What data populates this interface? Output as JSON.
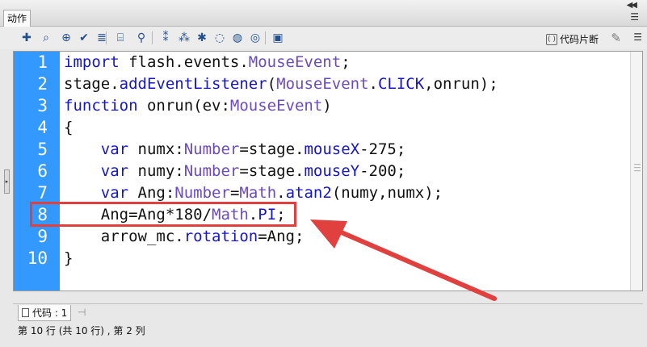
{
  "panel": {
    "tab_label": "动作",
    "collapse_glyph": "◀◀",
    "menu_glyph": "☰"
  },
  "toolbar": {
    "icons": [
      {
        "name": "add-statement-icon",
        "glyph": "✚"
      },
      {
        "name": "find-icon",
        "glyph": "⌕"
      },
      {
        "name": "target-path-icon",
        "glyph": "⊕"
      },
      {
        "name": "check-syntax-icon",
        "glyph": "✔"
      },
      {
        "name": "auto-format-icon",
        "glyph": "≣"
      },
      {
        "name": "show-code-hint-icon",
        "glyph": "⌸"
      },
      {
        "name": "debug-options-icon",
        "glyph": "⚲"
      },
      {
        "name": "collapse-braces-icon",
        "glyph": "⁑"
      },
      {
        "name": "collapse-selection-icon",
        "glyph": "⁂"
      },
      {
        "name": "expand-all-icon",
        "glyph": "✱"
      },
      {
        "name": "apply-block-comment-icon",
        "glyph": "◌"
      },
      {
        "name": "apply-line-comment-icon",
        "glyph": "◍"
      },
      {
        "name": "remove-comment-icon",
        "glyph": "◎"
      },
      {
        "name": "show-hide-toolbox-icon",
        "glyph": "▣"
      }
    ],
    "snippets_label": "代码片断",
    "snippets_icon": "( )",
    "wizard_glyph": "✎",
    "menu_glyph": "☰"
  },
  "editor": {
    "line_numbers": [
      "1",
      "2",
      "3",
      "4",
      "5",
      "6",
      "7",
      "8",
      "9",
      "10"
    ],
    "lines": [
      [
        {
          "t": "import",
          "c": "kw"
        },
        {
          "t": " flash.events.",
          "c": ""
        },
        {
          "t": "MouseEvent",
          "c": "tp"
        },
        {
          "t": ";",
          "c": ""
        }
      ],
      [
        {
          "t": "stage.",
          "c": ""
        },
        {
          "t": "addEventListener",
          "c": "kw"
        },
        {
          "t": "(",
          "c": ""
        },
        {
          "t": "MouseEvent",
          "c": "tp"
        },
        {
          "t": ".",
          "c": ""
        },
        {
          "t": "CLICK",
          "c": "kw"
        },
        {
          "t": ",onrun);",
          "c": ""
        }
      ],
      [
        {
          "t": "function",
          "c": "kw"
        },
        {
          "t": " onrun(ev:",
          "c": ""
        },
        {
          "t": "MouseEvent",
          "c": "tp"
        },
        {
          "t": ")",
          "c": ""
        }
      ],
      [
        {
          "t": "{",
          "c": ""
        }
      ],
      [
        {
          "t": "    ",
          "c": ""
        },
        {
          "t": "var",
          "c": "kw"
        },
        {
          "t": " numx:",
          "c": ""
        },
        {
          "t": "Number",
          "c": "tp"
        },
        {
          "t": "=stage.",
          "c": ""
        },
        {
          "t": "mouseX",
          "c": "kw"
        },
        {
          "t": "-275;",
          "c": ""
        }
      ],
      [
        {
          "t": "    ",
          "c": ""
        },
        {
          "t": "var",
          "c": "kw"
        },
        {
          "t": " numy:",
          "c": ""
        },
        {
          "t": "Number",
          "c": "tp"
        },
        {
          "t": "=stage.",
          "c": ""
        },
        {
          "t": "mouseY",
          "c": "kw"
        },
        {
          "t": "-200;",
          "c": ""
        }
      ],
      [
        {
          "t": "    ",
          "c": ""
        },
        {
          "t": "var",
          "c": "kw"
        },
        {
          "t": " Ang:",
          "c": ""
        },
        {
          "t": "Number",
          "c": "tp"
        },
        {
          "t": "=",
          "c": ""
        },
        {
          "t": "Math",
          "c": "tp"
        },
        {
          "t": ".",
          "c": ""
        },
        {
          "t": "atan2",
          "c": "kw"
        },
        {
          "t": "(numy,numx);",
          "c": ""
        }
      ],
      [
        {
          "t": "    Ang=Ang*180/",
          "c": ""
        },
        {
          "t": "Math",
          "c": "tp"
        },
        {
          "t": ".",
          "c": ""
        },
        {
          "t": "PI",
          "c": "kw"
        },
        {
          "t": ";",
          "c": ""
        }
      ],
      [
        {
          "t": "    arrow_mc.",
          "c": ""
        },
        {
          "t": "rotation",
          "c": "kw"
        },
        {
          "t": "=Ang;",
          "c": ""
        }
      ],
      [
        {
          "t": "}",
          "c": ""
        }
      ]
    ]
  },
  "bottom": {
    "code_tab_label": "代码 : 1",
    "pin_glyph": "⊣",
    "status_text": "第 10 行 (共 10 行) , 第 2 列"
  },
  "colors": {
    "gutter": "#3399ff",
    "keyword": "#1616c6",
    "type": "#6b4bbf",
    "annotation": "#e0403e"
  }
}
